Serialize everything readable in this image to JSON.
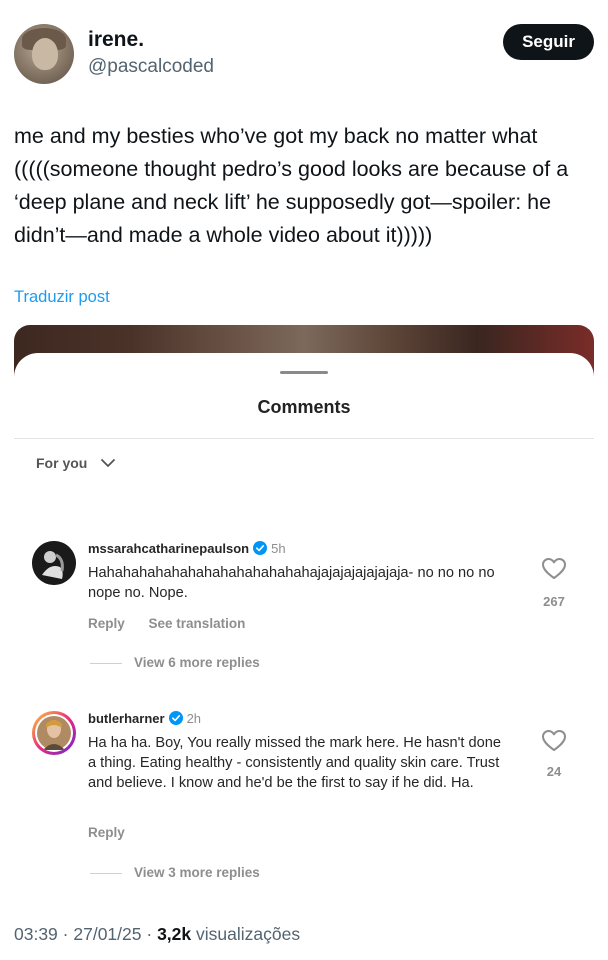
{
  "author": {
    "name": "irene.",
    "handle": "@pascalcoded",
    "follow_label": "Seguir"
  },
  "tweet": {
    "text": "me and my besties who’ve got my back no matter what (((((someone thought pedro’s good looks are because of a ‘deep plane and neck lift’ he supposedly got—spoiler: he didn’t—and made a whole video about it)))))",
    "translate_label": "Traduzir post"
  },
  "embedded_screenshot": {
    "title": "Comments",
    "filter_label": "For you",
    "comments": [
      {
        "username": "mssarahcatharinepaulson",
        "time": "5h",
        "text": "Hahahahahahahahahahahahahahajajajajajajajaja- no no no no nope no. Nope.",
        "likes": "267",
        "actions": [
          "Reply",
          "See translation"
        ],
        "more_replies": "View 6 more replies"
      },
      {
        "username": "butlerharner",
        "time": "2h",
        "text": "Ha ha ha. Boy, You really missed the mark here. He hasn't done a thing. Eating healthy - consistently and quality skin care. Trust and believe. I know and he'd be the first to say if he did. Ha.",
        "likes": "24",
        "actions": [
          "Reply"
        ],
        "more_replies": "View 3 more replies"
      }
    ]
  },
  "meta": {
    "time": "03:39",
    "separator": "·",
    "date": "27/01/25",
    "views_count": "3,2k",
    "views_label": "visualizações"
  },
  "colors": {
    "link": "#1d9bf0",
    "verified": "#0095f6",
    "secondary_text": "#536471",
    "follow_button": "#0f1419"
  }
}
